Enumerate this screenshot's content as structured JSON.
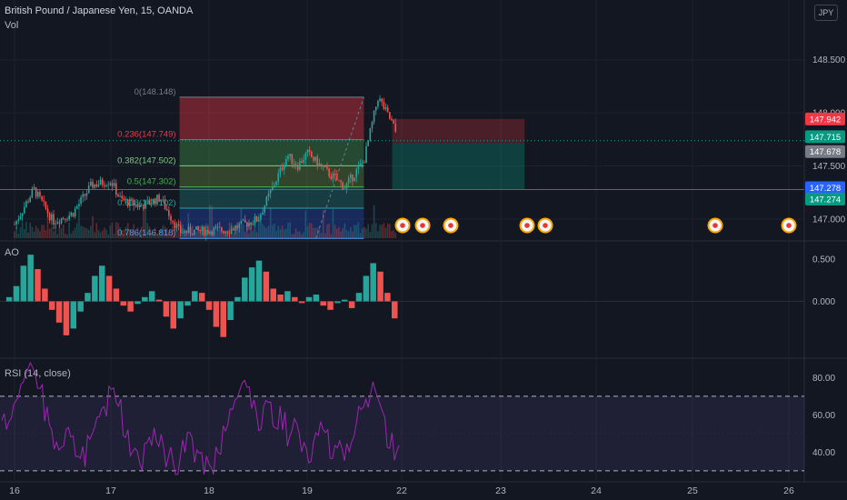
{
  "header": {
    "symbol": "British Pound / Japanese Yen, 15, OANDA",
    "volume_label": "Vol",
    "currency_button": "JPY"
  },
  "panes": {
    "ao_label": "AO",
    "rsi_label": "RSI (14, close)"
  },
  "price_labels": [
    {
      "text": "147.942",
      "color": "#f23645"
    },
    {
      "text": "147.715",
      "color": "#089981"
    },
    {
      "text": "147.678",
      "color": "#787b86"
    },
    {
      "text": "147.278",
      "color": "#2962ff"
    },
    {
      "text": "147.274",
      "color": "#089981"
    }
  ],
  "colors": {
    "background": "#131722",
    "up": "#26a69a",
    "down": "#ef5350",
    "rsi": "#9c27b0",
    "horizontal_line": "#2962ff"
  },
  "chart_data": [
    {
      "type": "candlestick",
      "title": "British Pound / Japanese Yen, 15, OANDA",
      "x_ticks": [
        "16",
        "17",
        "18",
        "19",
        "22",
        "23",
        "24",
        "25",
        "26"
      ],
      "y_ticks": [
        "148.500",
        "148.000",
        "147.500",
        "147.000"
      ],
      "ylim": [
        146.82,
        148.72
      ],
      "price_path": [
        {
          "date": "16",
          "price": 146.95
        },
        {
          "date": "16.2",
          "price": 147.28
        },
        {
          "date": "16.4",
          "price": 146.98
        },
        {
          "date": "16.6",
          "price": 147.05
        },
        {
          "date": "16.8",
          "price": 147.32
        },
        {
          "date": "17",
          "price": 147.36
        },
        {
          "date": "17.1",
          "price": 147.18
        },
        {
          "date": "17.3",
          "price": 147.12
        },
        {
          "date": "17.5",
          "price": 147.2
        },
        {
          "date": "17.7",
          "price": 146.88
        },
        {
          "date": "18.2",
          "price": 146.9
        },
        {
          "date": "18.5",
          "price": 147.0
        },
        {
          "date": "18.8",
          "price": 147.6
        },
        {
          "date": "18.9",
          "price": 147.5
        },
        {
          "date": "19",
          "price": 147.62
        },
        {
          "date": "19.2",
          "price": 147.45
        },
        {
          "date": "19.4",
          "price": 147.3
        },
        {
          "date": "19.6",
          "price": 147.55
        },
        {
          "date": "19.75",
          "price": 148.148
        },
        {
          "date": "19.9",
          "price": 147.9
        },
        {
          "date": "22",
          "price": 147.678
        }
      ],
      "horizontal_line": 147.278,
      "current_price": 147.678
    },
    {
      "type": "fibonacci",
      "levels": [
        {
          "ratio": "0",
          "price": 148.148,
          "label": "0(148.148)"
        },
        {
          "ratio": "0.236",
          "price": 147.749,
          "label": "0.236(147.749)"
        },
        {
          "ratio": "0.382",
          "price": 147.502,
          "label": "0.382(147.502)"
        },
        {
          "ratio": "0.5",
          "price": 147.302,
          "label": "0.5(147.302)"
        },
        {
          "ratio": "0.618",
          "price": 147.102,
          "label": "0.618(147.102)"
        },
        {
          "ratio": "0.786",
          "price": 146.818,
          "label": "0.786(146.818)"
        }
      ]
    },
    {
      "type": "position",
      "entry": 147.715,
      "stop": 147.942,
      "target": 147.274,
      "direction": "short"
    },
    {
      "type": "bar",
      "name": "AO",
      "y_ticks": [
        "0.500",
        "0.000"
      ],
      "ylim": [
        -0.68,
        0.68
      ],
      "values": [
        0.0,
        0.05,
        0.18,
        0.42,
        0.55,
        0.38,
        0.15,
        -0.1,
        -0.25,
        -0.4,
        -0.32,
        -0.12,
        0.1,
        0.3,
        0.42,
        0.3,
        0.15,
        -0.05,
        -0.12,
        -0.03,
        0.05,
        0.12,
        0.02,
        -0.18,
        -0.32,
        -0.2,
        -0.05,
        0.12,
        0.1,
        -0.1,
        -0.3,
        -0.42,
        -0.22,
        0.05,
        0.28,
        0.4,
        0.48,
        0.35,
        0.15,
        0.08,
        0.12,
        0.05,
        -0.02,
        0.05,
        0.08,
        -0.05,
        -0.1,
        -0.02,
        0.02,
        -0.08,
        0.1,
        0.3,
        0.45,
        0.35,
        0.1,
        -0.2
      ]
    },
    {
      "type": "line",
      "name": "RSI (14, close)",
      "y_ticks": [
        "80.00",
        "60.00",
        "40.00"
      ],
      "ylim": [
        27,
        89
      ],
      "band": [
        30,
        70
      ],
      "values": [
        55,
        62,
        72,
        80,
        85,
        75,
        60,
        48,
        42,
        50,
        44,
        38,
        45,
        55,
        62,
        70,
        65,
        52,
        42,
        35,
        42,
        50,
        45,
        38,
        34,
        40,
        48,
        40,
        33,
        30,
        38,
        52,
        62,
        75,
        78,
        65,
        58,
        62,
        55,
        58,
        50,
        52,
        45,
        40,
        55,
        48,
        38,
        44,
        40,
        50,
        60,
        68,
        75,
        62,
        48,
        40
      ]
    }
  ]
}
